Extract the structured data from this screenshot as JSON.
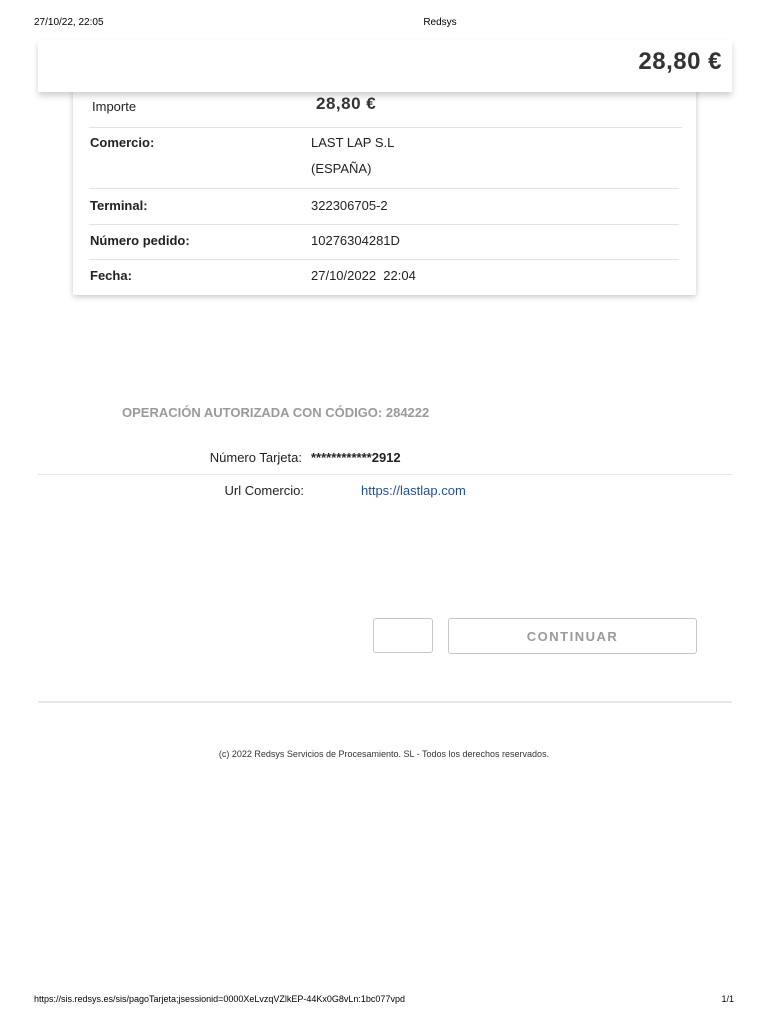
{
  "print_header": {
    "datetime": "27/10/22, 22:05",
    "title": "Redsys"
  },
  "top_bar": {
    "amount": "28,80 €"
  },
  "details": {
    "importe_label": "Importe",
    "importe_value": "28,80 €",
    "comercio_label": "Comercio:",
    "comercio_line1": "LAST LAP S.L",
    "comercio_line2": "(ESPAÑA)",
    "terminal_label": "Terminal:",
    "terminal_value": "322306705-2",
    "pedido_label": "Número pedido:",
    "pedido_value": "10276304281D",
    "fecha_label": "Fecha:",
    "fecha_value": "27/10/2022  22:04"
  },
  "result": {
    "authorization_text": "OPERACIÓN AUTORIZADA CON CÓDIGO:  284222",
    "card_label": "Número Tarjeta:",
    "card_masked": "************",
    "card_last4": "2912",
    "url_label": "Url Comercio:",
    "url_value": "https://lastlap.com"
  },
  "actions": {
    "continue_label": "CONTINUAR"
  },
  "footer": {
    "copyright": "(c) 2022 Redsys Servicios de Procesamiento. SL - Todos los derechos reservados."
  },
  "print_footer": {
    "url": "https://sis.redsys.es/sis/pagoTarjeta;jsessionid=0000XeLvzqVZlkEP-44Kx0G8vLn:1bc077vpd",
    "page": "1/1"
  }
}
